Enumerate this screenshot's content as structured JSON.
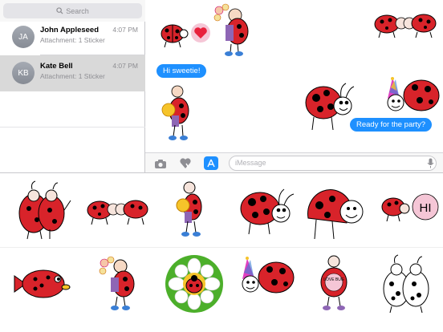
{
  "search": {
    "placeholder": "Search"
  },
  "conversations": [
    {
      "initials": "JA",
      "name": "John Appleseed",
      "time": "4:07 PM",
      "preview": "Attachment: 1 Sticker",
      "selected": false
    },
    {
      "initials": "KB",
      "name": "Kate Bell",
      "time": "4:07 PM",
      "preview": "Attachment: 1 Sticker",
      "selected": true
    }
  ],
  "messages": {
    "received_text": "Hi sweetie!",
    "sent_text": "Ready for the party?"
  },
  "composer": {
    "placeholder": "iMessage",
    "icons": [
      "camera-icon",
      "heart-touch-icon",
      "app-store-icon",
      "microphone-icon"
    ]
  },
  "stickers": [
    {
      "name": "sticker-ladybug-pair-hug"
    },
    {
      "name": "sticker-ladybugs-kissing"
    },
    {
      "name": "sticker-ladybug-flowers"
    },
    {
      "name": "sticker-ladybug-smile"
    },
    {
      "name": "sticker-ladybug-big-smile"
    },
    {
      "name": "sticker-ladybug-hi",
      "text": "HI"
    },
    {
      "name": "sticker-fish"
    },
    {
      "name": "sticker-ladybug-bouquet"
    },
    {
      "name": "sticker-ladybug-in-flower"
    },
    {
      "name": "sticker-ladybug-party-hat"
    },
    {
      "name": "sticker-ladybug-love-bug",
      "text": "LOVE BUG"
    },
    {
      "name": "sticker-dalmatian-ladybugs"
    }
  ],
  "colors": {
    "bubble_blue": "#1e90ff",
    "ladybug_red": "#d8232a",
    "selected_row": "#d9d9d9",
    "composer_app_blue": "#1e90ff"
  }
}
